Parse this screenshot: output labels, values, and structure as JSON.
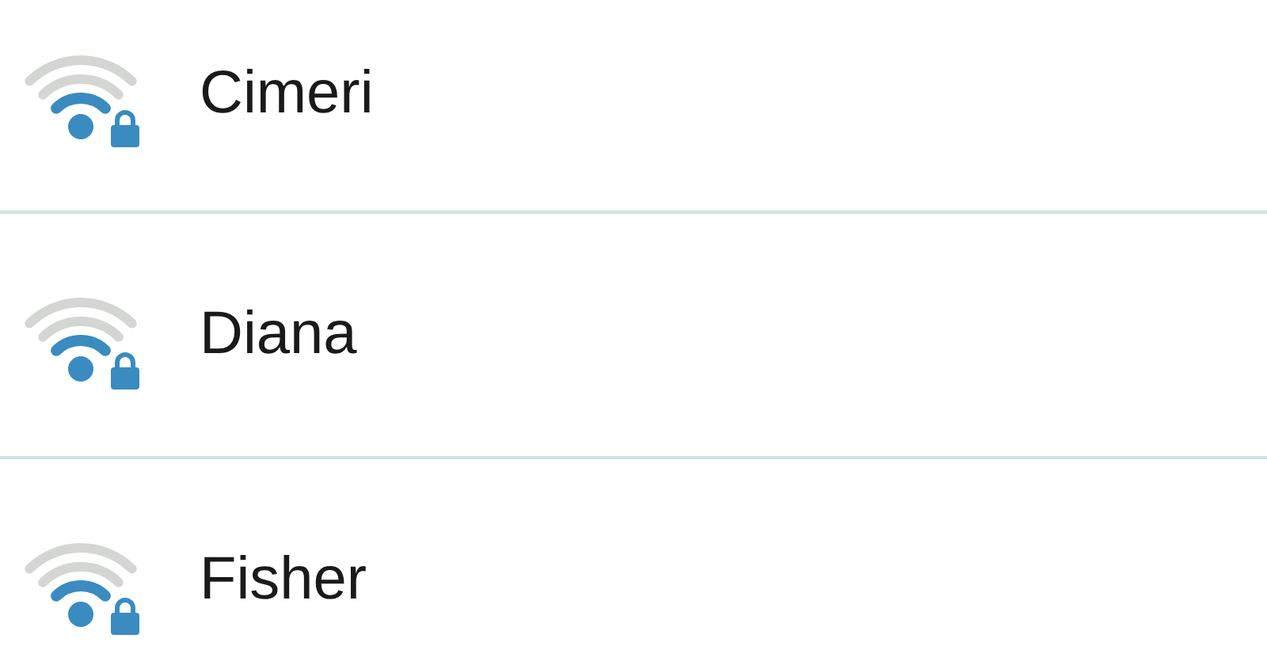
{
  "networks": [
    {
      "name": "Cimeri"
    },
    {
      "name": "Diana"
    },
    {
      "name": "Fisher"
    }
  ]
}
